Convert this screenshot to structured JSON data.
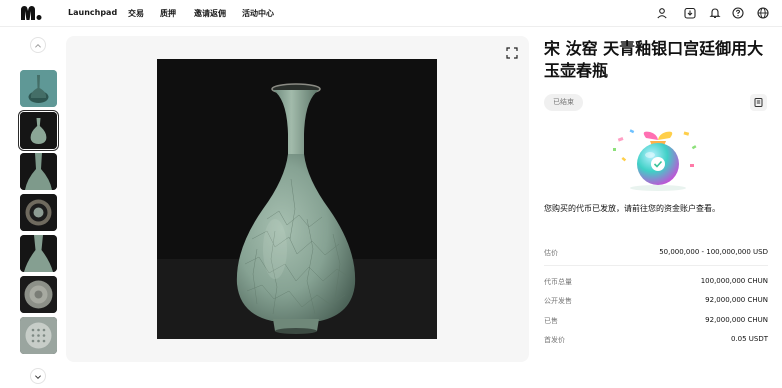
{
  "nav": {
    "items": [
      "Launchpad",
      "交易",
      "质押",
      "邀请返佣",
      "活动中心"
    ]
  },
  "product": {
    "title": "宋 汝窑 天青釉银口宫廷御用大玉壶春瓶",
    "status": "已结束",
    "notice": "您购买的代币已发放，请前往您的资金账户查看。",
    "estimate": {
      "label": "估价",
      "value": "50,000,000 - 100,000,000 USD"
    },
    "stats": [
      {
        "label": "代币总量",
        "value": "100,000,000 CHUN"
      },
      {
        "label": "公开发售",
        "value": "92,000,000 CHUN"
      },
      {
        "label": "已售",
        "value": "92,000,000 CHUN"
      },
      {
        "label": "首发价",
        "value": "0.05 USDT"
      }
    ]
  },
  "colors": {
    "accent": "#111111",
    "panel_bg": "#f6f6f6",
    "vase_glaze": "#8ea99b"
  },
  "icons": [
    "logo-icon",
    "user-icon",
    "download-icon",
    "bell-icon",
    "help-icon",
    "globe-icon",
    "expand-icon",
    "chevron-up-icon",
    "chevron-down-icon",
    "document-icon"
  ]
}
